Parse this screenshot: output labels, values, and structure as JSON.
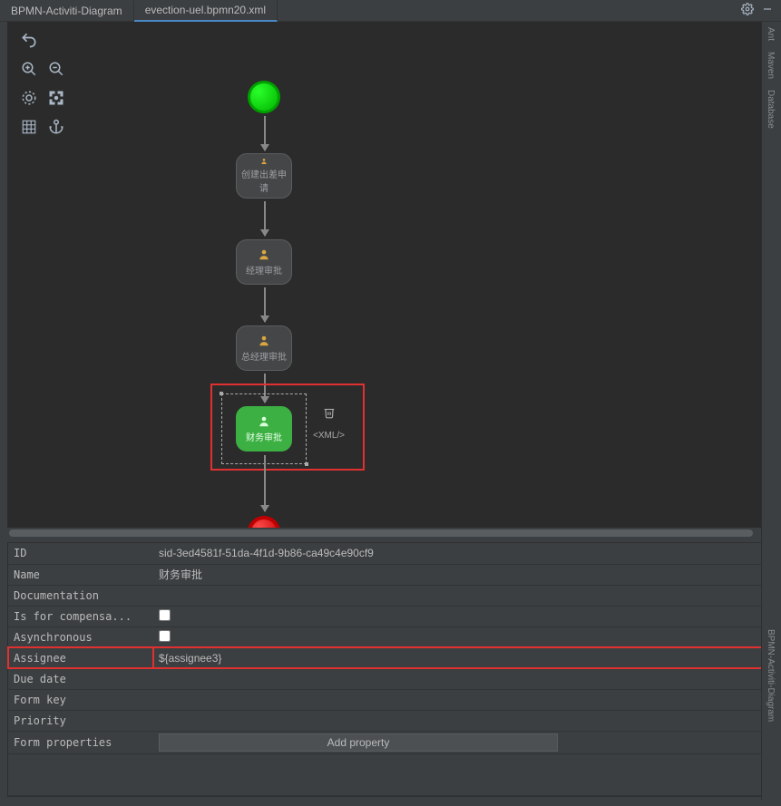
{
  "tabs": {
    "tab1": "BPMN-Activiti-Diagram",
    "tab2": "evection-uel.bpmn20.xml"
  },
  "flow": {
    "task1": "创建出差申请",
    "task2": "经理审批",
    "task3": "总经理审批",
    "task4": "财务审批",
    "xml_label": "<XML/>"
  },
  "props": {
    "id_label": "ID",
    "id_value": "sid-3ed4581f-51da-4f1d-9b86-ca49c4e90cf9",
    "name_label": "Name",
    "name_value": "财务审批",
    "doc_label": "Documentation",
    "doc_value": "",
    "comp_label": "Is for compensa...",
    "async_label": "Asynchronous",
    "assignee_label": "Assignee",
    "assignee_value": "${assignee3}",
    "due_label": "Due date",
    "due_value": "",
    "formkey_label": "Form key",
    "formkey_value": "",
    "priority_label": "Priority",
    "priority_value": "",
    "formprops_label": "Form properties",
    "add_btn": "Add property"
  },
  "side": {
    "ant": "Ant",
    "maven": "Maven",
    "database": "Database",
    "bpmn": "BPMN-Activiti-Diagram"
  }
}
